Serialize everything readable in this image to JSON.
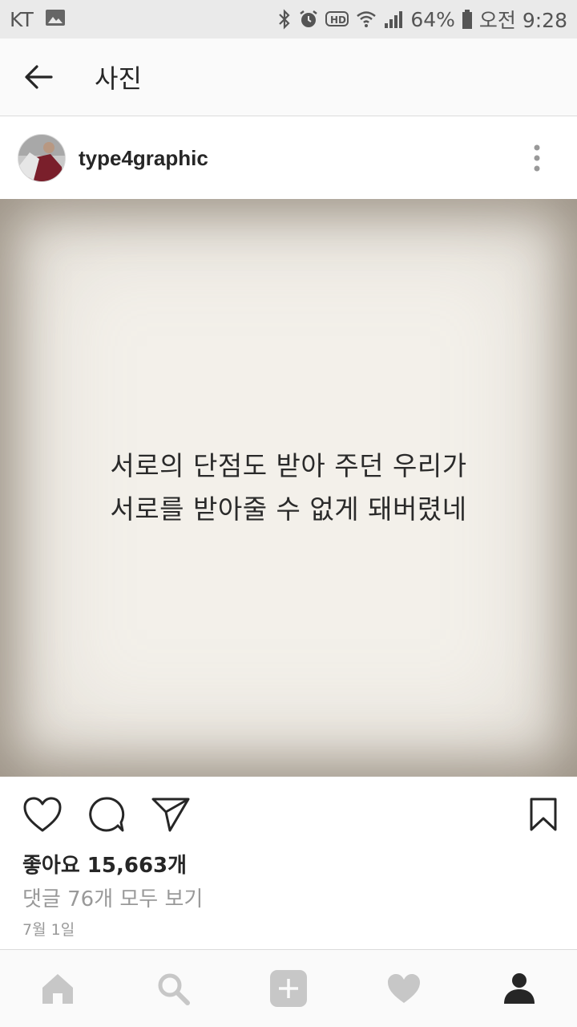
{
  "status_bar": {
    "carrier": "KT",
    "battery": "64%",
    "time": "오전 9:28",
    "icons": [
      "image-icon",
      "bluetooth-icon",
      "alarm-icon",
      "hd-icon",
      "wifi-icon",
      "signal-icon",
      "battery-icon"
    ]
  },
  "top_bar": {
    "title": "사진"
  },
  "post": {
    "username": "type4graphic",
    "quote_lines": [
      "서로의 단점도 받아 주던 우리가",
      "서로를 받아줄 수 없게 돼버렸네"
    ],
    "likes": "좋아요 15,663개",
    "comments_link": "댓글 76개 모두 보기",
    "date": "7월 1일"
  },
  "bottom_nav": {
    "items": [
      "home-icon",
      "search-icon",
      "add-icon",
      "heart-icon",
      "profile-icon"
    ]
  },
  "colors": {
    "muted": "#999999",
    "nav_icon": "#c7c7c7",
    "text": "#262626"
  }
}
